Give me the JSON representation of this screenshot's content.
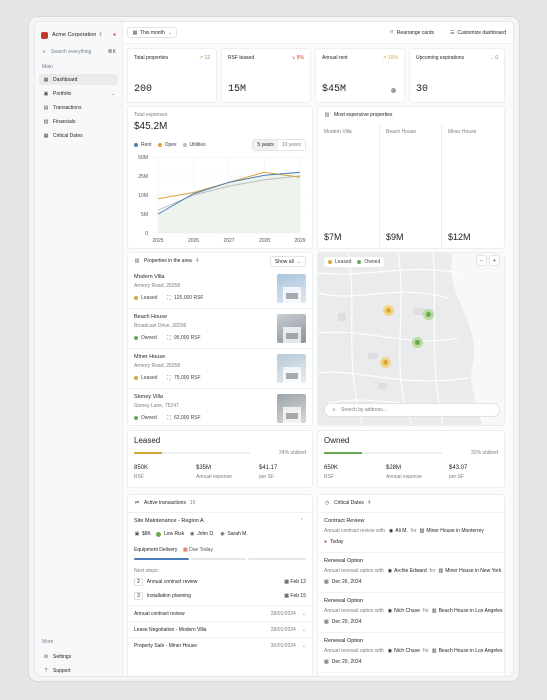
{
  "org": {
    "name": "Acme Corporation"
  },
  "search": {
    "placeholder": "Search everything",
    "shortcut": "⌘K"
  },
  "sidebar": {
    "section_main": "Main",
    "items": [
      {
        "label": "Dashboard",
        "icon": "grid-icon",
        "active": true
      },
      {
        "label": "Portfolio",
        "icon": "briefcase-icon",
        "expandable": true
      },
      {
        "label": "Transactions",
        "icon": "file-icon"
      },
      {
        "label": "Financials",
        "icon": "doc-icon"
      },
      {
        "label": "Critical Dates",
        "icon": "calendar-icon"
      }
    ],
    "section_more": "More",
    "more_items": [
      {
        "label": "Settings",
        "icon": "gear-icon"
      },
      {
        "label": "Support",
        "icon": "help-icon"
      }
    ]
  },
  "toolbar": {
    "period": "This month",
    "rearrange": "Rearrange cards",
    "customize": "Customize dashboard"
  },
  "kpis": [
    {
      "label": "Total properties",
      "delta": "12",
      "delta_dir": "up",
      "value": "200"
    },
    {
      "label": "RSF leased",
      "delta": "8%",
      "delta_dir": "down",
      "value": "15M"
    },
    {
      "label": "Annual rent",
      "delta": "15%",
      "delta_dir": "up",
      "value": "$45M"
    },
    {
      "label": "Upcoming expirations",
      "delta": "0",
      "delta_dir": "flat",
      "value": "30"
    }
  ],
  "expenses": {
    "label": "Total expenses",
    "value": "$45.2M",
    "range_options": [
      "5 years",
      "10 years"
    ],
    "range_selected": "5 years",
    "legend": [
      {
        "name": "Rent",
        "color": "#4a7fb8"
      },
      {
        "name": "Opex",
        "color": "#d9a63a"
      },
      {
        "name": "Utilities",
        "color": "#b9bdc2"
      }
    ]
  },
  "chart_data": {
    "type": "line",
    "x": [
      "2025",
      "2026",
      "2027",
      "2028",
      "2029"
    ],
    "ylim": [
      0,
      50
    ],
    "yticks": [
      "0",
      "5M",
      "10M",
      "25M",
      "50M"
    ],
    "series": [
      {
        "name": "Rent",
        "values": [
          5,
          11,
          20,
          26,
          30
        ]
      },
      {
        "name": "Opex",
        "values": [
          9,
          12,
          20,
          30,
          24
        ]
      },
      {
        "name": "Utilities",
        "values": [
          6,
          10,
          17,
          22,
          25
        ]
      }
    ]
  },
  "expensive": {
    "title": "Most expensive properties",
    "items": [
      {
        "name": "Modern Villa",
        "value": "$7M"
      },
      {
        "name": "Beach House",
        "value": "$9M"
      },
      {
        "name": "Miner House",
        "value": "$12M"
      }
    ]
  },
  "area": {
    "title": "Properties in the area",
    "count": "4",
    "show_all": "Show all",
    "items": [
      {
        "name": "Modern Villa",
        "address": "Armory Road, 28358",
        "status": "Leased",
        "status_color": "#d9a63a",
        "rsf": "125,000 RSF"
      },
      {
        "name": "Beach House",
        "address": "Broadcast Drive, 28206",
        "status": "Owned",
        "status_color": "#6aa84f",
        "rsf": "95,000 RSF"
      },
      {
        "name": "Miner House",
        "address": "Armory Road, 28358",
        "status": "Leased",
        "status_color": "#d9a63a",
        "rsf": "75,000 RSF"
      },
      {
        "name": "Stoney Villa",
        "address": "Stoney Lane, 75247",
        "status": "Owned",
        "status_color": "#6aa84f",
        "rsf": "62,000 RSF"
      }
    ]
  },
  "map": {
    "legend": [
      {
        "label": "Leased",
        "color": "#d9a63a"
      },
      {
        "label": "Owned",
        "color": "#6aa84f"
      }
    ],
    "zoom_out": "−",
    "zoom_in": "+",
    "search_placeholder": "Search by address..."
  },
  "leased": {
    "title": "Leased",
    "utilized": "24% utilized",
    "utilized_fraction": 0.24,
    "color": "#d9a63a",
    "stats": [
      {
        "value": "850K",
        "label": "RSF"
      },
      {
        "value": "$35M",
        "label": "Annual expense"
      },
      {
        "value": "$41.17",
        "label": "per SF"
      }
    ]
  },
  "owned": {
    "title": "Owned",
    "utilized": "32% utilized",
    "utilized_fraction": 0.32,
    "color": "#6aa84f",
    "stats": [
      {
        "value": "650K",
        "label": "RSF"
      },
      {
        "value": "$28M",
        "label": "Annual expense"
      },
      {
        "value": "$43.07",
        "label": "per SF"
      }
    ]
  },
  "transactions": {
    "title": "Active transactions",
    "count": "16",
    "expanded": {
      "name": "Site Maintenance - Region A",
      "budget": "$8K",
      "risk": "Low Risk",
      "people": [
        "John D.",
        "Sarah M."
      ],
      "task": "Equipment Delivery",
      "task_due": "Due Today",
      "next_label": "Next steps:",
      "steps": [
        {
          "n": "2",
          "label": "Annual contract review",
          "date": "Feb 12"
        },
        {
          "n": "3",
          "label": "Installation planning",
          "date": "Feb 15"
        }
      ]
    },
    "rows": [
      {
        "name": "Annual contract review",
        "date": "28/01/2024"
      },
      {
        "name": "Lease Negotiation - Modern Villa",
        "date": "28/01/2024"
      },
      {
        "name": "Property Sale - Miner House",
        "date": "30/01/2024"
      }
    ]
  },
  "critical": {
    "title": "Critical Dates",
    "count": "4",
    "items": [
      {
        "type": "Contract Review",
        "desc": "Annual contract review with",
        "person": "Ali M.",
        "for": "for",
        "place": "Miner House in Monterrey",
        "date": "Today",
        "urgent": true
      },
      {
        "type": "Renewal Option",
        "desc": "Annual renewal option with",
        "person": "Archie Edward",
        "for": "for",
        "place": "Miner House in New York",
        "date": "Dec 26, 2024"
      },
      {
        "type": "Renewal Option",
        "desc": "Annual renewal option with",
        "person": "Nich Chase",
        "for": "for",
        "place": "Beach House in Los Angeles",
        "date": "Dec 29, 2024"
      },
      {
        "type": "Renewal Option",
        "desc": "Annual renewal option with",
        "person": "Nich Chase",
        "for": "for",
        "place": "Beach House in Los Angeles",
        "date": "Dec 29, 2024"
      }
    ]
  }
}
